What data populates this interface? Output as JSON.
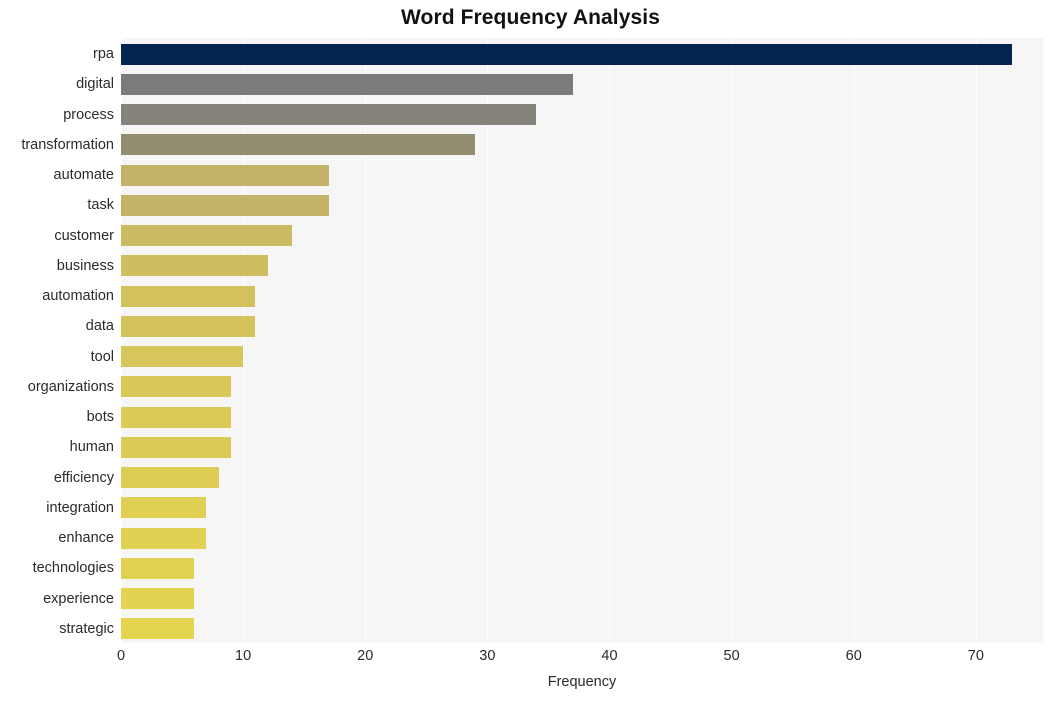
{
  "chart_data": {
    "type": "bar",
    "orientation": "horizontal",
    "title": "Word Frequency Analysis",
    "xlabel": "Frequency",
    "ylabel": "",
    "xlim": [
      0,
      75.5
    ],
    "xticks": [
      0,
      10,
      20,
      30,
      40,
      50,
      60,
      70
    ],
    "xtick_labels": [
      "0",
      "10",
      "20",
      "30",
      "40",
      "50",
      "60",
      "70"
    ],
    "grid": true,
    "grid_axis": "x",
    "legend": "none",
    "plot_background": "#f6f6f6",
    "figure_background": "#ffffff",
    "categories": [
      "rpa",
      "digital",
      "process",
      "transformation",
      "automate",
      "task",
      "customer",
      "business",
      "automation",
      "data",
      "tool",
      "organizations",
      "bots",
      "human",
      "efficiency",
      "integration",
      "enhance",
      "technologies",
      "experience",
      "strategic"
    ],
    "values": [
      73,
      37,
      34,
      29,
      17,
      17,
      14,
      12,
      11,
      11,
      10,
      9,
      9,
      9,
      8,
      7,
      7,
      6,
      6,
      6
    ],
    "bar_colors": [
      "#042551",
      "#7b7b7b",
      "#85837b",
      "#928c70",
      "#c3b369",
      "#c3b366",
      "#cbbb63",
      "#cfbe60",
      "#d2c15d",
      "#d4c35c",
      "#d7c65a",
      "#d9c858",
      "#dbca57",
      "#dcca56",
      "#decd55",
      "#e0cf53",
      "#e1d052",
      "#e3d251",
      "#e4d350",
      "#e5d44f"
    ]
  }
}
